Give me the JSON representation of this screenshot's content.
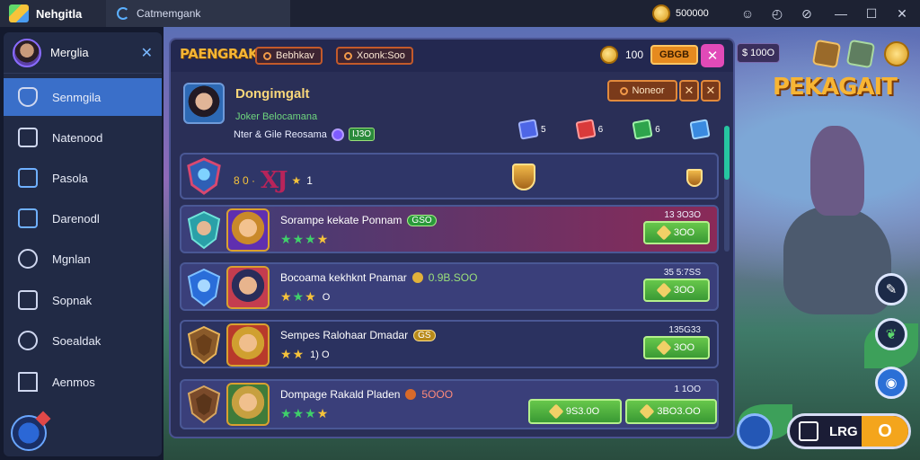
{
  "topbar": {
    "app_name": "Nehgitla",
    "tab_label": "Catmemgank",
    "coins": "500000",
    "controls": [
      "☺",
      "◴",
      "⊘",
      "—",
      "☐",
      "✕"
    ]
  },
  "sidebar": {
    "user_name": "Merglia",
    "items": [
      {
        "label": "Senmgila",
        "icon": "shield-icon",
        "active": true
      },
      {
        "label": "Natenood",
        "icon": "box-icon"
      },
      {
        "label": "Pasola",
        "icon": "home-icon"
      },
      {
        "label": "Darenodl",
        "icon": "bookmark-icon"
      },
      {
        "label": "Mgnlan",
        "icon": "compass-icon"
      },
      {
        "label": "Sopnak",
        "icon": "window-icon"
      },
      {
        "label": "Soealdak",
        "icon": "search-icon"
      },
      {
        "label": "Aenmos",
        "icon": "house-icon"
      }
    ]
  },
  "panel": {
    "logo": "PAENGRAK",
    "pill_1": "Bebhkav",
    "pill_2": "Xoonk:Soo",
    "coin_value": "100",
    "coin_chip": "GBGB",
    "close": "✕",
    "profile": {
      "title": "Dongimgalt",
      "sub": "Joker Belocamana",
      "sub2": "Nter & Gile Reosama",
      "sub2_badge": "IJ3O",
      "button": "Noneor",
      "resources": [
        "5",
        "6",
        "6",
        ""
      ]
    },
    "row0": {
      "prefix": "8 0 ·",
      "big": "XJ",
      "count": "1"
    },
    "rows": [
      {
        "name": "Sorampe kekate Ponnam",
        "badge": "GSO",
        "price": "13 3O3O",
        "buy": "3OO",
        "stars": [
          "g",
          "g",
          "g",
          "y"
        ],
        "count": ""
      },
      {
        "name": "Bocoama kekhknt Pnamar",
        "badge": "0.9B.SOO",
        "price": "35 5:7SS",
        "buy": "3OO",
        "stars": [
          "y",
          "g",
          "y"
        ],
        "count": "O"
      },
      {
        "name": "Sempes Ralohaar Dmadar",
        "badge": "GS",
        "price": "135G33",
        "buy": "3OO",
        "stars": [
          "y",
          "y"
        ],
        "count": "1) O"
      },
      {
        "name": "Dompage Rakald Pladen",
        "badge": "5OOO",
        "price": "1 1OO",
        "buy_a": "9S3.0O",
        "buy_b": "3BO3.OO",
        "stars": [
          "g",
          "g",
          "g",
          "y"
        ],
        "count": ""
      }
    ]
  },
  "hud": {
    "title": "PEKAGAIT",
    "price": "$ 100O",
    "score": "LRG",
    "score_o": "O"
  }
}
